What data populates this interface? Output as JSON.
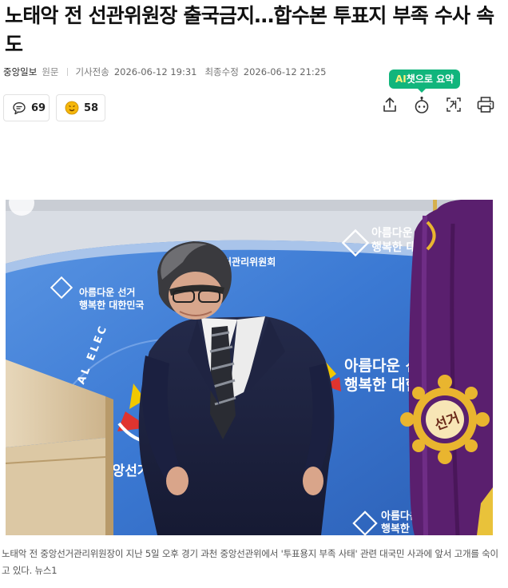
{
  "article": {
    "title": "노태악 전 선관위원장 출국금지…합수본 투표지 부족 수사 속도",
    "press": "중앙일보",
    "original_label": "원문",
    "sent_label": "기사전송",
    "sent_time": "2026-06-12 19:31",
    "modified_label": "최종수정",
    "modified_time": "2026-06-12 21:25"
  },
  "ai_badge": {
    "ai": "AI",
    "rest": "챗으로 요약"
  },
  "reactions": {
    "comments": "69",
    "likes": "58"
  },
  "toolbar_icons": [
    "share-icon",
    "ai-bot-icon",
    "font-size-icon",
    "print-icon"
  ],
  "photo": {
    "backdrop_text_1": "아름다운 선거",
    "backdrop_text_2": "행복한 대한민국",
    "backdrop_org": "중앙선거관리위원회",
    "backdrop_org_right": "거관리위원회",
    "backdrop_arc": "NATIONAL ELEC",
    "flag_text": "선거"
  },
  "caption": "노태악 전 중앙선거관리위원장이 지난 5일 오후 경기 과천 중앙선관위에서 '투표용지 부족 사태' 관련 대국민 사과에 앞서 고개를 숙이고 있다. 뉴스1",
  "colors": {
    "ai_green": "#11b57c",
    "backdrop_blue": "#3f7fd6",
    "flag_purple": "#5a1f6e",
    "flag_gold": "#e9b52f"
  }
}
